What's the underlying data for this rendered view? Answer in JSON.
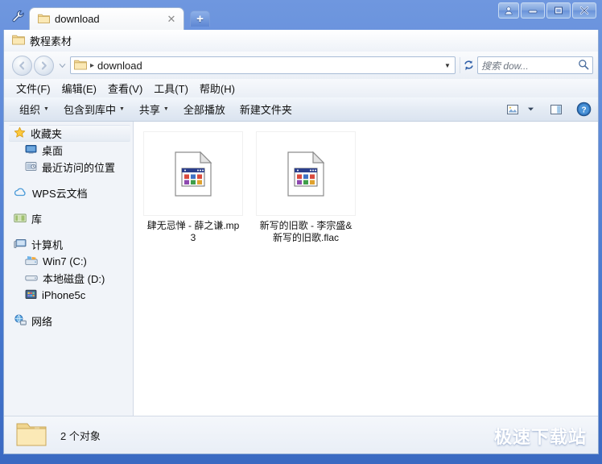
{
  "window": {
    "caption_buttons": [
      {
        "name": "user-account",
        "glyph": "△"
      },
      {
        "name": "minimize",
        "glyph": "–"
      },
      {
        "name": "maximize",
        "glyph": "□"
      },
      {
        "name": "close",
        "glyph": "✕"
      }
    ]
  },
  "tabs": {
    "wrench_tooltip": "工具",
    "items": [
      {
        "label": "download",
        "close": "✕"
      }
    ],
    "new_tab": "+"
  },
  "bookmark_bar": {
    "items": [
      {
        "label": "教程素材"
      }
    ]
  },
  "address_bar": {
    "back": "◀",
    "forward": "▶",
    "recent_caret": "▾",
    "crumb_sep": "▸",
    "path": "download",
    "dropdown": "▼",
    "refresh": "↻"
  },
  "search": {
    "placeholder": "搜索 dow...",
    "icon": "⚲"
  },
  "menu": {
    "items": [
      "文件(F)",
      "编辑(E)",
      "查看(V)",
      "工具(T)",
      "帮助(H)"
    ]
  },
  "toolbar": {
    "items": [
      {
        "label": "组织",
        "caret": "▼"
      },
      {
        "label": "包含到库中",
        "caret": "▼"
      },
      {
        "label": "共享",
        "caret": "▼"
      },
      {
        "label": "全部播放",
        "caret": ""
      },
      {
        "label": "新建文件夹",
        "caret": ""
      }
    ],
    "view_caret": "▼"
  },
  "nav_pane": {
    "groups": [
      {
        "items": [
          {
            "label": "收藏夹",
            "icon": "star-icon",
            "level": 0,
            "selected": true
          },
          {
            "label": "桌面",
            "icon": "desktop-icon",
            "level": 1,
            "selected": false
          },
          {
            "label": "最近访问的位置",
            "icon": "recent-places-icon",
            "level": 1,
            "selected": false
          }
        ]
      },
      {
        "items": [
          {
            "label": "WPS云文档",
            "icon": "cloud-icon",
            "level": 0,
            "selected": false
          }
        ]
      },
      {
        "items": [
          {
            "label": "库",
            "icon": "library-icon",
            "level": 0,
            "selected": false
          }
        ]
      },
      {
        "items": [
          {
            "label": "计算机",
            "icon": "computer-icon",
            "level": 0,
            "selected": false
          },
          {
            "label": "Win7 (C:)",
            "icon": "windows-drive-icon",
            "level": 1,
            "selected": false
          },
          {
            "label": "本地磁盘 (D:)",
            "icon": "drive-icon",
            "level": 1,
            "selected": false
          },
          {
            "label": "iPhone5c",
            "icon": "device-icon",
            "level": 1,
            "selected": false
          }
        ]
      },
      {
        "items": [
          {
            "label": "网络",
            "icon": "network-icon",
            "level": 0,
            "selected": false
          }
        ]
      }
    ]
  },
  "files": [
    {
      "name": "肆无忌惮 - 薛之谦.mp3",
      "icon": "generic-file-icon"
    },
    {
      "name": "新写的旧歌 - 李宗盛&新写的旧歌.flac",
      "icon": "generic-file-icon"
    }
  ],
  "status": {
    "text": "2 个对象"
  },
  "watermark": {
    "text": "极速下载站"
  },
  "colors": {
    "titlebar_top": "#6f97df",
    "titlebar_bottom": "#3a69c2",
    "client_bg": "#f1f4f9",
    "content_bg": "#ffffff",
    "folder_yellow": "#f5d98a",
    "watermark": "#ffffff"
  }
}
